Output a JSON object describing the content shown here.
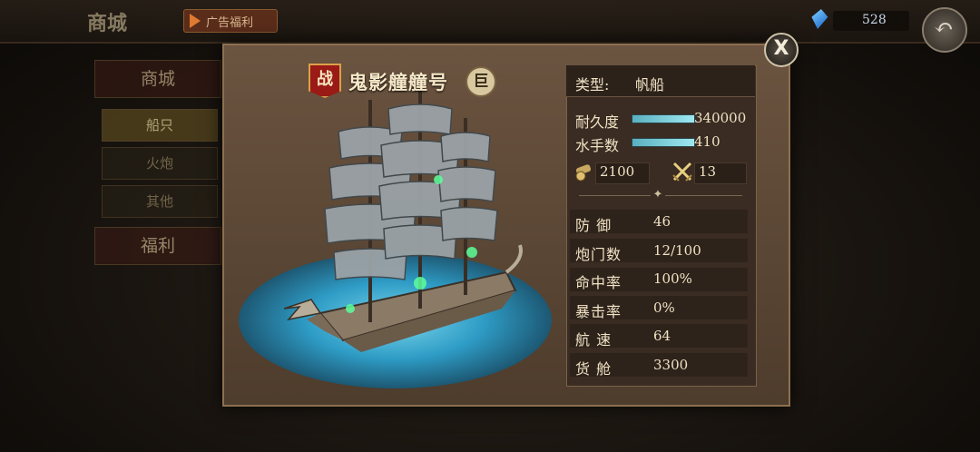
{
  "background": {
    "title": "商城",
    "ad_button_label": "广告福利",
    "gems": "528",
    "side_tabs": [
      "商城",
      "福利"
    ],
    "side_sub": [
      "船只",
      "火炮",
      "其他"
    ]
  },
  "dialog": {
    "war_badge": "战",
    "ship_name": "鬼影艟艟号",
    "size_badge": "巨",
    "close_label": "X",
    "type_label": "类型:",
    "type_value": "帆船",
    "bars": [
      {
        "label": "耐久度",
        "value": "340000",
        "fill_fraction": 1.0
      },
      {
        "label": "水手数",
        "value": "410",
        "fill_fraction": 1.0
      }
    ],
    "cannon_power": "2100",
    "attack_value": "13",
    "stats": [
      {
        "label": "防 御",
        "value": "46"
      },
      {
        "label": "炮门数",
        "value": "12/100"
      },
      {
        "label": "命中率",
        "value": "100%"
      },
      {
        "label": "暴击率",
        "value": "0%"
      },
      {
        "label": "航 速",
        "value": "64"
      },
      {
        "label": "货 舱",
        "value": "3300"
      }
    ]
  },
  "colors": {
    "accent_gold": "#d8a24a",
    "bar_fill": "#9ee8f0",
    "war_red": "#9a1a16"
  },
  "icons": {
    "gem": "blue-gem-icon",
    "back": "back-arrow-icon",
    "cannon": "cannon-icon",
    "swords": "crossed-swords-icon",
    "ornament": "divider-ornament-icon"
  }
}
